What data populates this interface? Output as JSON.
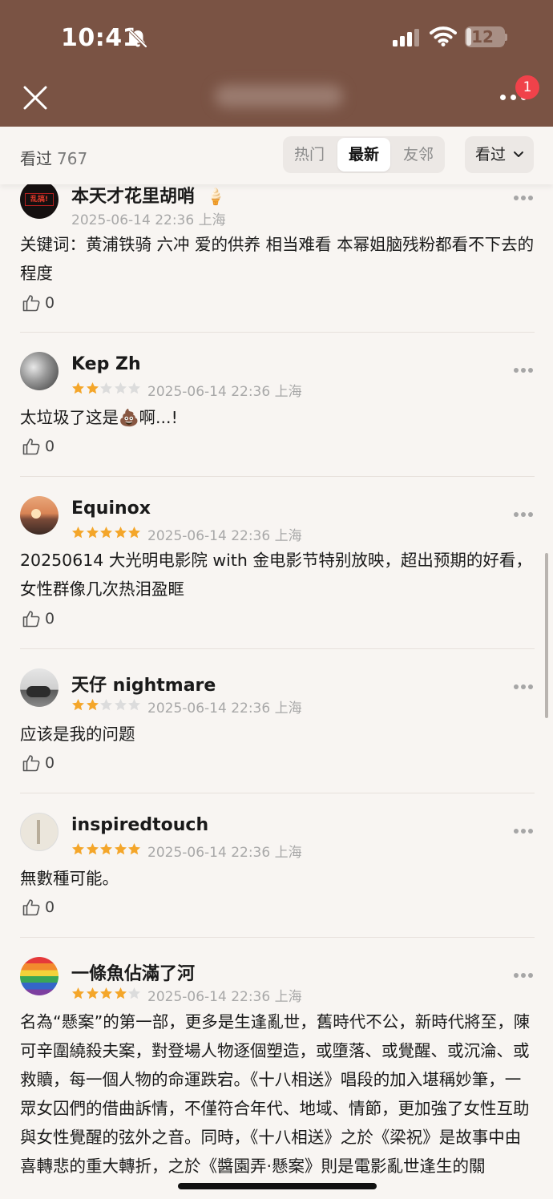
{
  "status_bar": {
    "time": "10:41",
    "battery": "12",
    "battery_level": 0.12
  },
  "header": {
    "notification_count": "1"
  },
  "filter_bar": {
    "watched_label": "看过",
    "watched_count": "767",
    "tabs": [
      "热门",
      "最新",
      "友邻"
    ],
    "active_tab": "最新",
    "dropdown_label": "看过"
  },
  "reviews": [
    {
      "username": "本天才花里胡哨",
      "emoji": "🍦",
      "avatar_text": "乱搞!",
      "rating": 0,
      "timestamp": "2025-06-14 22:36 上海",
      "content": "关键词：黄浦铁骑 六冲 爱的供养 相当难看 本幂姐脑残粉都看不下去的程度",
      "likes": "0"
    },
    {
      "username": "Kep Zh",
      "rating": 2,
      "timestamp": "2025-06-14 22:36 上海",
      "content": "太垃圾了这是💩啊...!",
      "likes": "0"
    },
    {
      "username": "Equinox",
      "rating": 5,
      "timestamp": "2025-06-14 22:36 上海",
      "content": "20250614 大光明电影院 with 金电影节特别放映，超出预期的好看，女性群像几次热泪盈眶",
      "likes": "0"
    },
    {
      "username": "天仔 nightmare",
      "rating": 2,
      "timestamp": "2025-06-14 22:36 上海",
      "content": "应该是我的问题",
      "likes": "0"
    },
    {
      "username": "inspiredtouch",
      "rating": 5,
      "timestamp": "2025-06-14 22:36 上海",
      "content": "無數種可能。",
      "likes": "0"
    },
    {
      "username": "一條魚佔滿了河",
      "rating": 4,
      "timestamp": "2025-06-14 22:36 上海",
      "content": "名為“懸案”的第一部，更多是生逢亂世，舊時代不公，新時代將至，陳可辛圍繞殺夫案，對登場人物逐個塑造，或墮落、或覺醒、或沉淪、或救贖，每一個人物的命運跌宕。《十八相送》唱段的加入堪稱妙筆，一眾女囚們的借曲訴情，不僅符合年代、地域、情節，更加強了女性互助與女性覺醒的弦外之音。同時，《十八相送》之於《梁祝》是故事中由喜轉悲的重大轉折，之於《醬園弄·懸案》則是電影亂世逢生的關"
    }
  ],
  "colors": {
    "header_bg": "#7a5344",
    "page_bg": "#f8f5f2",
    "star_filled": "#f4a62a",
    "star_empty": "#dcdcdc",
    "badge": "#f0424a"
  }
}
